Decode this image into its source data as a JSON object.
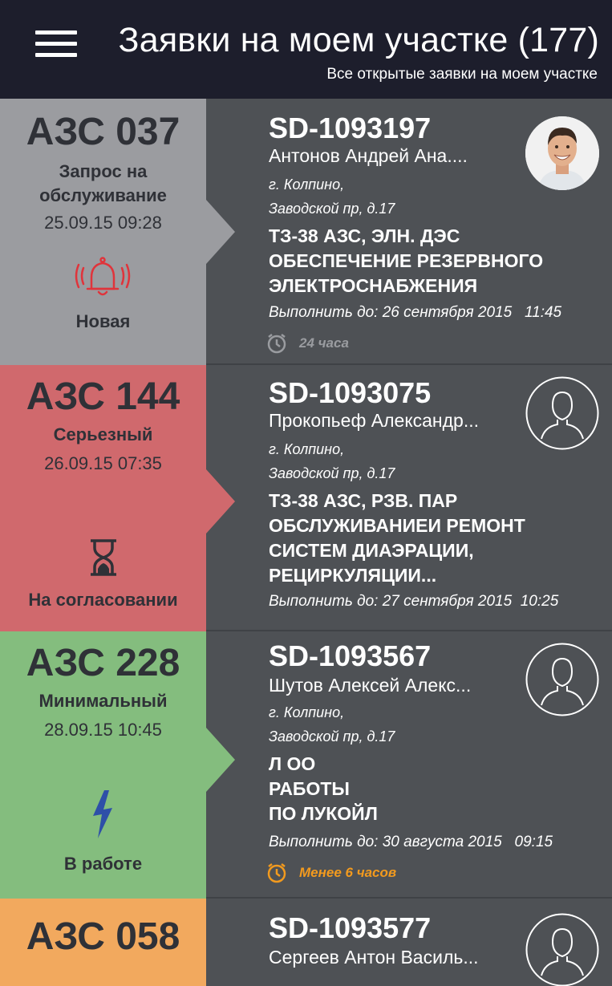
{
  "header": {
    "title": "Заявки на моем участке (177)",
    "subtitle": "Все открытые заявки на моем участке"
  },
  "colors": {
    "header_bg": "#1d1e2c",
    "new": "#9b9ca0",
    "serious": "#d0696d",
    "minimal": "#84bd7e",
    "orange": "#f2a95e",
    "timer_warning": "#f29a1e",
    "timer_normal": "#9a9ca0"
  },
  "tickets": [
    {
      "station": "АЗС 037",
      "priority": "Запрос на обслуживание",
      "date": "25.09.15 09:28",
      "status_icon": "bell-icon",
      "status": "Новая",
      "id": "SD-1093197",
      "person": "Антонов Андрей Ана....",
      "city": "г. Колпино,",
      "street": "Заводской пр, д.17",
      "subject": [
        "ТЗ-38 АЗС, ЭЛН. ДЭС",
        "ОБЕСПЕЧЕНИЕ РЕЗЕРВНОГО",
        "ЭЛЕКТРОСНАБЖЕНИЯ"
      ],
      "deadline": "Выполнить до: 26 сентября 2015   11:45",
      "timer": "24 часа",
      "avatar": "photo"
    },
    {
      "station": "АЗС 144",
      "priority": "Серьезный",
      "date": "26.09.15 07:35",
      "status_icon": "hourglass-icon",
      "status": "На согласовании",
      "id": "SD-1093075",
      "person": "Прокопьеф Александр...",
      "city": "г. Колпино,",
      "street": "Заводской пр, д.17",
      "subject": [
        "ТЗ-38 АЗС, РЗВ. ПАР",
        "ОБСЛУЖИВАНИЕИ РЕМОНТ",
        "СИСТЕМ ДИАЭРАЦИИ,",
        "РЕЦИРКУЛЯЦИИ..."
      ],
      "deadline": "Выполнить до: 27 сентября 2015  10:25",
      "avatar": "placeholder"
    },
    {
      "station": "АЗС 228",
      "priority": "Минимальный",
      "date": "28.09.15 10:45",
      "status_icon": "lightning-icon",
      "status": "В работе",
      "id": "SD-1093567",
      "person": "Шутов Алексей Алекс...",
      "city": "г. Колпино,",
      "street": "Заводской пр, д.17",
      "subject": [
        "Л ОО",
        "РАБОТЫ",
        "ПО ЛУКОЙЛ"
      ],
      "deadline": "Выполнить до: 30 августа 2015   09:15",
      "timer": "Менее 6 часов",
      "avatar": "placeholder"
    },
    {
      "station": "АЗС 058",
      "id": "SD-1093577",
      "person": "Сергеев Антон Василь...",
      "avatar": "placeholder"
    }
  ]
}
